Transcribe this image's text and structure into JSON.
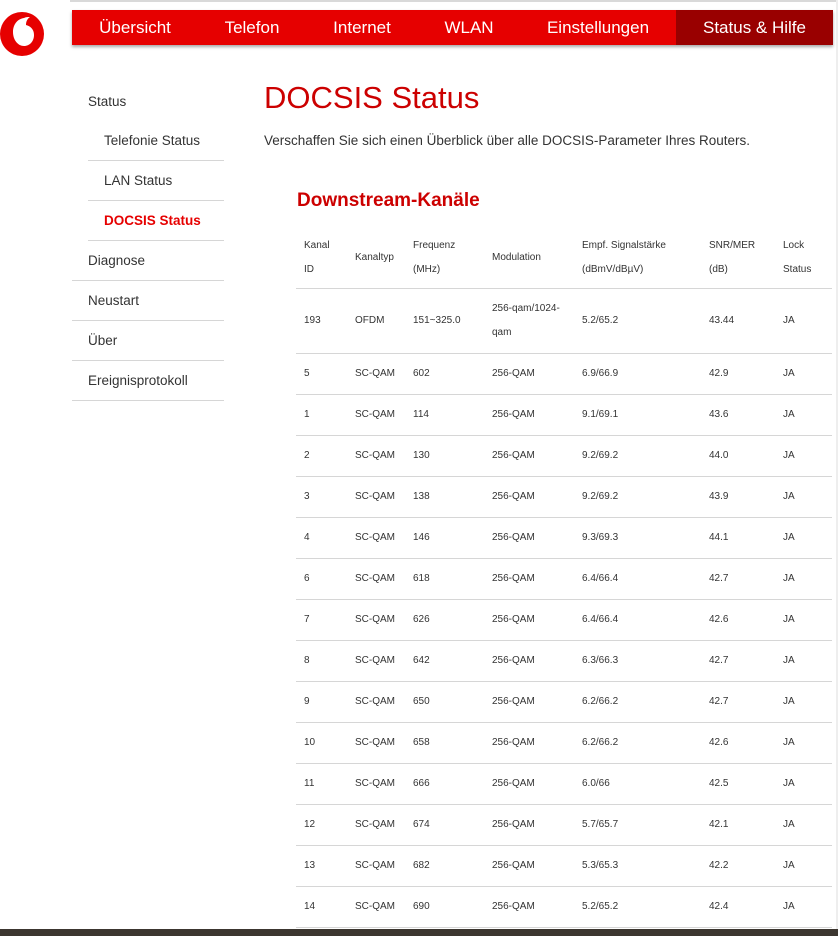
{
  "nav": {
    "items": [
      {
        "label": "Übersicht",
        "name": "nav-uebersicht",
        "width": 126
      },
      {
        "label": "Telefon",
        "name": "nav-telefon",
        "width": 108
      },
      {
        "label": "Internet",
        "name": "nav-internet",
        "width": 112
      },
      {
        "label": "WLAN",
        "name": "nav-wlan",
        "width": 102
      },
      {
        "label": "Einstellungen",
        "name": "nav-einstellungen",
        "width": 156
      },
      {
        "label": "Status & Hilfe",
        "name": "nav-status-hilfe",
        "width": 157
      }
    ],
    "active_index": 5
  },
  "sidebar": {
    "items": [
      {
        "label": "Status",
        "type": "header"
      },
      {
        "label": "Telefonie Status",
        "type": "sub"
      },
      {
        "label": "LAN Status",
        "type": "sub"
      },
      {
        "label": "DOCSIS Status",
        "type": "sub",
        "active": true
      },
      {
        "label": "Diagnose",
        "type": "top"
      },
      {
        "label": "Neustart",
        "type": "top"
      },
      {
        "label": "Über",
        "type": "top"
      },
      {
        "label": "Ereignisprotokoll",
        "type": "top"
      }
    ]
  },
  "page": {
    "title": "DOCSIS Status",
    "description": "Verschaffen Sie sich einen Überblick über alle DOCSIS-Parameter Ihres Routers."
  },
  "downstream": {
    "title": "Downstream-Kanäle",
    "headers": [
      [
        "Kanal",
        "ID"
      ],
      [
        "Kanaltyp"
      ],
      [
        "Frequenz",
        "(MHz)"
      ],
      [
        "Modulation"
      ],
      [
        "Empf. Signalstärke",
        "(dBmV/dBµV)"
      ],
      [
        "SNR/MER",
        "(dB)"
      ],
      [
        "Lock",
        "Status"
      ]
    ],
    "rows": [
      [
        "193",
        "OFDM",
        "151~325.0",
        "256-qam/1024-qam",
        "5.2/65.2",
        "43.44",
        "JA"
      ],
      [
        "5",
        "SC-QAM",
        "602",
        "256-QAM",
        "6.9/66.9",
        "42.9",
        "JA"
      ],
      [
        "1",
        "SC-QAM",
        "114",
        "256-QAM",
        "9.1/69.1",
        "43.6",
        "JA"
      ],
      [
        "2",
        "SC-QAM",
        "130",
        "256-QAM",
        "9.2/69.2",
        "44.0",
        "JA"
      ],
      [
        "3",
        "SC-QAM",
        "138",
        "256-QAM",
        "9.2/69.2",
        "43.9",
        "JA"
      ],
      [
        "4",
        "SC-QAM",
        "146",
        "256-QAM",
        "9.3/69.3",
        "44.1",
        "JA"
      ],
      [
        "6",
        "SC-QAM",
        "618",
        "256-QAM",
        "6.4/66.4",
        "42.7",
        "JA"
      ],
      [
        "7",
        "SC-QAM",
        "626",
        "256-QAM",
        "6.4/66.4",
        "42.6",
        "JA"
      ],
      [
        "8",
        "SC-QAM",
        "642",
        "256-QAM",
        "6.3/66.3",
        "42.7",
        "JA"
      ],
      [
        "9",
        "SC-QAM",
        "650",
        "256-QAM",
        "6.2/66.2",
        "42.7",
        "JA"
      ],
      [
        "10",
        "SC-QAM",
        "658",
        "256-QAM",
        "6.2/66.2",
        "42.6",
        "JA"
      ],
      [
        "11",
        "SC-QAM",
        "666",
        "256-QAM",
        "6.0/66",
        "42.5",
        "JA"
      ],
      [
        "12",
        "SC-QAM",
        "674",
        "256-QAM",
        "5.7/65.7",
        "42.1",
        "JA"
      ],
      [
        "13",
        "SC-QAM",
        "682",
        "256-QAM",
        "5.3/65.3",
        "42.2",
        "JA"
      ],
      [
        "14",
        "SC-QAM",
        "690",
        "256-QAM",
        "5.2/65.2",
        "42.4",
        "JA"
      ]
    ]
  },
  "colors": {
    "brand_red": "#e60000",
    "active_nav": "#990000",
    "title_red": "#cc0000"
  },
  "icons": {
    "logo": "vodafone-logo-icon"
  }
}
